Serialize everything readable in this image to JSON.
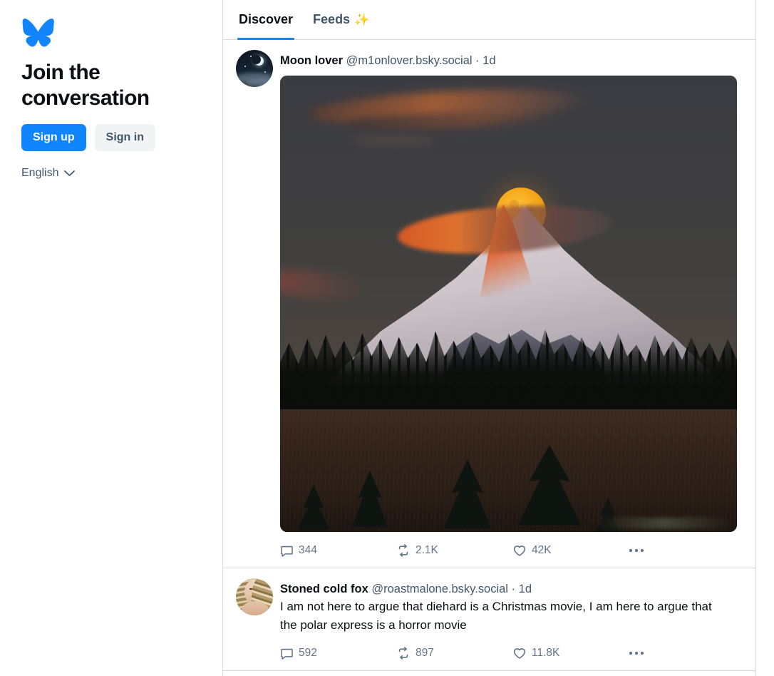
{
  "sidebar": {
    "logo_icon": "bluesky-butterfly-logo",
    "title": "Join the conversation",
    "sign_up_label": "Sign up",
    "sign_in_label": "Sign in",
    "language_label": "English",
    "language_chevron_icon": "chevron-down-icon"
  },
  "tabs": [
    {
      "label": "Discover",
      "emoji": "",
      "active": true
    },
    {
      "label": "Feeds",
      "emoji": "✨",
      "active": false
    }
  ],
  "colors": {
    "brand_blue": "#1185fe",
    "secondary_button_bg": "#f1f3f5",
    "text_primary": "#0b0f14",
    "text_muted": "#42576c",
    "action_icon": "#637587",
    "border": "#d4dbe2"
  },
  "posts": [
    {
      "avatar_icon": "avatar-moon-night-sky",
      "display_name": "Moon lover",
      "handle": "@m1onlover.bsky.social",
      "separator": "·",
      "timestamp": "1d",
      "text": "",
      "media": {
        "alt": "Full orange moon rising over a snow-capped mountain at dusk with a dark treeline and field in the foreground"
      },
      "actions": {
        "reply_icon": "comment-icon",
        "reply_count": "344",
        "repost_icon": "repost-icon",
        "repost_count": "2.1K",
        "like_icon": "heart-icon",
        "like_count": "42K",
        "more_icon": "ellipsis-icon"
      }
    },
    {
      "avatar_icon": "avatar-selfie-portrait",
      "display_name": "Stoned cold fox",
      "handle": "@roastmalone.bsky.social",
      "separator": "·",
      "timestamp": "1d",
      "text": "I am not here to argue that diehard is a Christmas movie, I am here to argue that the polar express is a horror movie",
      "media": null,
      "actions": {
        "reply_icon": "comment-icon",
        "reply_count": "592",
        "repost_icon": "repost-icon",
        "repost_count": "897",
        "like_icon": "heart-icon",
        "like_count": "11.8K",
        "more_icon": "ellipsis-icon"
      }
    }
  ]
}
